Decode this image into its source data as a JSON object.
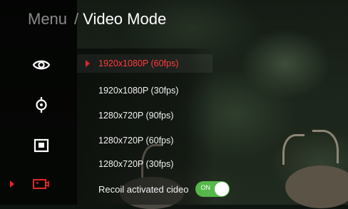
{
  "breadcrumb": {
    "menu_label": "Menu",
    "separator": "/",
    "title": "Video Mode"
  },
  "sidebar": {
    "items": [
      {
        "icon": "eye-icon",
        "active": false
      },
      {
        "icon": "crosshair-icon",
        "active": false
      },
      {
        "icon": "picture-in-picture-icon",
        "active": false
      },
      {
        "icon": "video-camera-icon",
        "active": true
      }
    ]
  },
  "video_modes": {
    "selected_index": 0,
    "options": [
      "1920x1080P (60fps)",
      "1920x1080P (30fps)",
      "1280x720P (90fps)",
      "1280x720P (60fps)",
      "1280x720P (30fps)"
    ]
  },
  "recoil": {
    "label": "Recoil activated cideo",
    "toggle_text": "ON",
    "enabled": true
  },
  "colors": {
    "accent_red": "#e3262b",
    "selected_text": "#ff3b3b",
    "toggle_green": "#55b84a"
  }
}
